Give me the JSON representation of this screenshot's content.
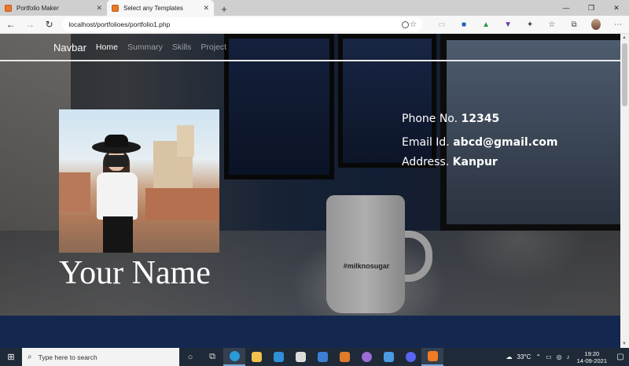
{
  "browser": {
    "tabs": [
      {
        "label": "Portfolio Maker",
        "active": false
      },
      {
        "label": "Select any Templates",
        "active": true
      }
    ],
    "new_tab": "+",
    "url": "localhost/portfolioes/portfolio1.php",
    "window_controls": {
      "minimize": "—",
      "maximize": "❐",
      "close": "✕"
    }
  },
  "navbar": {
    "brand": "Navbar",
    "links": [
      "Home",
      "Summary",
      "Skills",
      "Project"
    ],
    "active_link": "Home"
  },
  "hero": {
    "name": "Your Name",
    "mug_text": "#milknosugar",
    "contact": {
      "phone_label": "Phone No.",
      "phone_value": "12345",
      "email_label": "Email Id.",
      "email_value": "abcd@gmail.com",
      "address_label": "Address.",
      "address_value": "Kanpur"
    }
  },
  "taskbar": {
    "search_placeholder": "Type here to search",
    "weather": "33°C",
    "time": "19:20",
    "date": "14-09-2021"
  },
  "colors": {
    "footer_band": "#14284f",
    "taskbar": "#1f2a38",
    "tab_favicon": "#e8782a"
  }
}
